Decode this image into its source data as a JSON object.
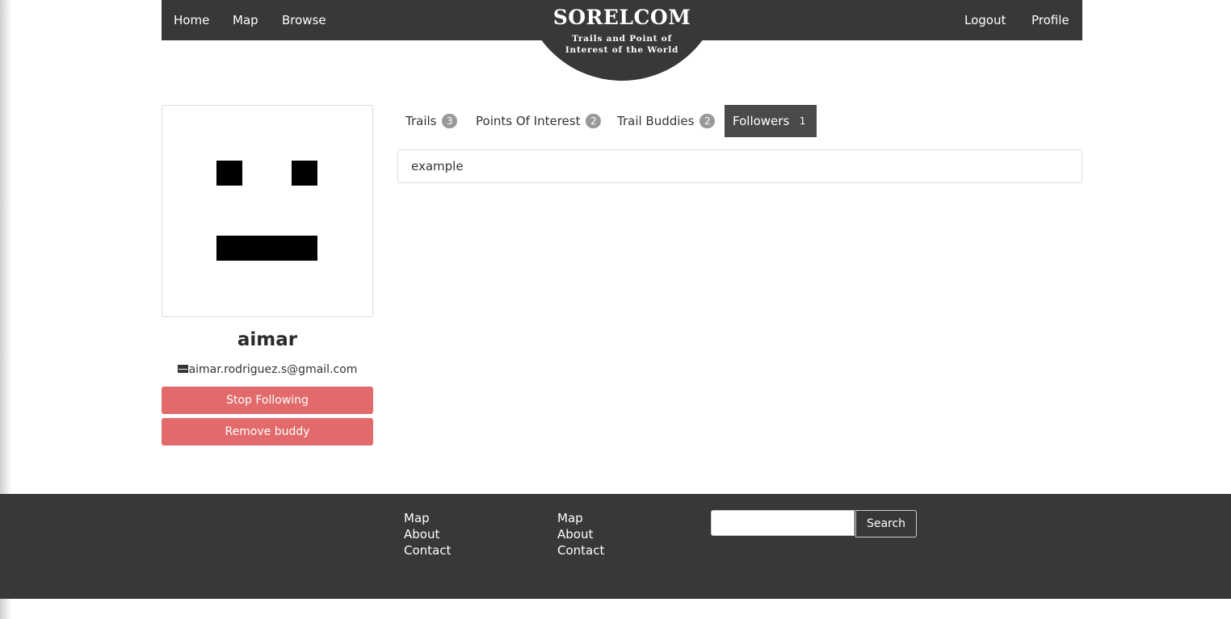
{
  "nav": {
    "left": [
      "Home",
      "Map",
      "Browse"
    ],
    "right": [
      "Logout",
      "Profile"
    ]
  },
  "logo": {
    "title": "SORELCOM",
    "subtitle_line1": "Trails and Point of",
    "subtitle_line2": "Interest of the World"
  },
  "profile": {
    "username": "aimar",
    "email": "aimar.rodriguez.s@gmail.com",
    "stop_following_label": "Stop Following",
    "remove_buddy_label": "Remove buddy"
  },
  "tabs": [
    {
      "label": "Trails",
      "count": "3"
    },
    {
      "label": "Points Of Interest",
      "count": "2"
    },
    {
      "label": "Trail Buddies",
      "count": "2"
    },
    {
      "label": "Followers",
      "count": "1",
      "active": true
    }
  ],
  "followers": [
    "example"
  ],
  "footer": {
    "col1": [
      "Map",
      "About",
      "Contact"
    ],
    "col2": [
      "Map",
      "About",
      "Contact"
    ],
    "search_label": "Search",
    "search_value": ""
  },
  "colors": {
    "navbar": "#383838",
    "button_red": "#e26a6a",
    "badge": "#999999"
  }
}
